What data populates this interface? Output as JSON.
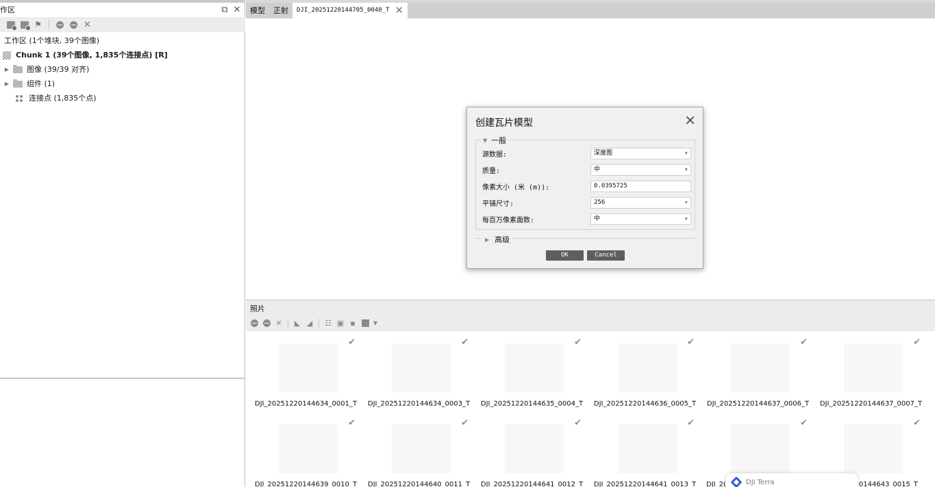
{
  "workspace": {
    "title": "作区",
    "summary": "工作区 (1个堆块, 39个图像)",
    "chunk_label": "Chunk 1 (39个图像, 1,835个连接点) [R]",
    "items": [
      {
        "label": "图像 (39/39 对齐)"
      },
      {
        "label": "组件 (1)"
      },
      {
        "label": "连接点 (1,835个点)"
      }
    ]
  },
  "tabs": [
    {
      "label": "模型"
    },
    {
      "label": "正射"
    },
    {
      "label": "DJI_20251220144705_0040_T"
    }
  ],
  "dialog": {
    "title": "创建瓦片模型",
    "general_label": "一般",
    "advanced_label": "高级",
    "fields": [
      {
        "label": "源数据:",
        "value": "深度图",
        "type": "select"
      },
      {
        "label": "质量:",
        "value": "中",
        "type": "select"
      },
      {
        "label": "像素大小 (米 (m)):",
        "value": "0.0395725",
        "type": "input"
      },
      {
        "label": "平铺尺寸:",
        "value": "256",
        "type": "select"
      },
      {
        "label": "每百万像素面数:",
        "value": "中",
        "type": "select"
      }
    ],
    "ok_label": "OK",
    "cancel_label": "Cancel"
  },
  "photos": {
    "title": "照片",
    "items": [
      {
        "caption": "DJI_20251220144634_0001_T"
      },
      {
        "caption": "DJI_20251220144634_0003_T"
      },
      {
        "caption": "DJI_20251220144635_0004_T"
      },
      {
        "caption": "DJI_20251220144636_0005_T"
      },
      {
        "caption": "DJI_20251220144637_0006_T"
      },
      {
        "caption": "DJI_20251220144637_0007_T"
      },
      {
        "caption": "DJI_20251220144639_0010_T"
      },
      {
        "caption": "DJI_20251220144640_0011_T"
      },
      {
        "caption": "DJI_20251220144641_0012_T"
      },
      {
        "caption": "DJI_20251220144641_0013_T"
      },
      {
        "caption": "DJI_2C"
      },
      {
        "caption": "220144643_0015_T"
      }
    ]
  },
  "toast": {
    "text": "DJI Terra"
  },
  "icons": [
    "restore-icon",
    "close-icon",
    "add-chunk-icon",
    "add-photos-icon",
    "add-marker-icon",
    "enable-icon",
    "disable-icon",
    "remove-icon",
    "check-icon",
    "grid-view-icon"
  ],
  "colors": {
    "dialog_button": "#5e5e5e",
    "toolbar": "#ececec",
    "tabbar": "#cfcfcf",
    "toast_logo": "#2a5bd7"
  }
}
